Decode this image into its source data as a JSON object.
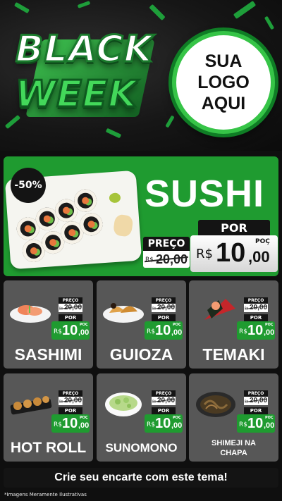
{
  "header": {
    "campaign_line1": "BLACK",
    "campaign_line2": "WEEK",
    "logo_line1": "SUA",
    "logo_line2": "LOGO",
    "logo_line3": "AQUI"
  },
  "featured": {
    "discount_badge": "-50%",
    "title": "SUSHI",
    "old_label": "PREÇO",
    "old_currency": "R$",
    "old_value": "20,00",
    "new_label": "POR",
    "new_currency": "R$",
    "new_int": "10",
    "new_dec": ",00",
    "new_poc": "POÇ"
  },
  "products": [
    {
      "name": "SASHIMI",
      "old_label": "PREÇO",
      "old_currency": "R$",
      "old_value": "20,00",
      "new_label": "POR",
      "currency": "R$",
      "int": "10",
      "dec": ",00",
      "poc": "POÇ"
    },
    {
      "name": "GUIOZA",
      "old_label": "PREÇO",
      "old_currency": "R$",
      "old_value": "20,00",
      "new_label": "POR",
      "currency": "R$",
      "int": "10",
      "dec": ",00",
      "poc": "POÇ"
    },
    {
      "name": "TEMAKI",
      "old_label": "PREÇO",
      "old_currency": "R$",
      "old_value": "20,00",
      "new_label": "POR",
      "currency": "R$",
      "int": "10",
      "dec": ",00",
      "poc": "POÇ"
    },
    {
      "name": "HOT ROLL",
      "old_label": "PREÇO",
      "old_currency": "R$",
      "old_value": "20,00",
      "new_label": "POR",
      "currency": "R$",
      "int": "10",
      "dec": ",00",
      "poc": "POÇ"
    },
    {
      "name": "SUNOMONO",
      "old_label": "PREÇO",
      "old_currency": "R$",
      "old_value": "20,00",
      "new_label": "POR",
      "currency": "R$",
      "int": "10",
      "dec": ",00",
      "poc": "POÇ"
    },
    {
      "name_line1": "SHIMEJI NA",
      "name_line2": "CHAPA",
      "old_label": "PREÇO",
      "old_currency": "R$",
      "old_value": "20,00",
      "new_label": "POR",
      "currency": "R$",
      "int": "10",
      "dec": ",00",
      "poc": "POÇ"
    }
  ],
  "footer": {
    "cta": "Crie seu encarte com este tema!",
    "disclaimer": "*Imagens Meramente Ilustrativas"
  },
  "colors": {
    "accent_green": "#1f9b30",
    "card_gray": "#575757",
    "dark": "#141414"
  }
}
